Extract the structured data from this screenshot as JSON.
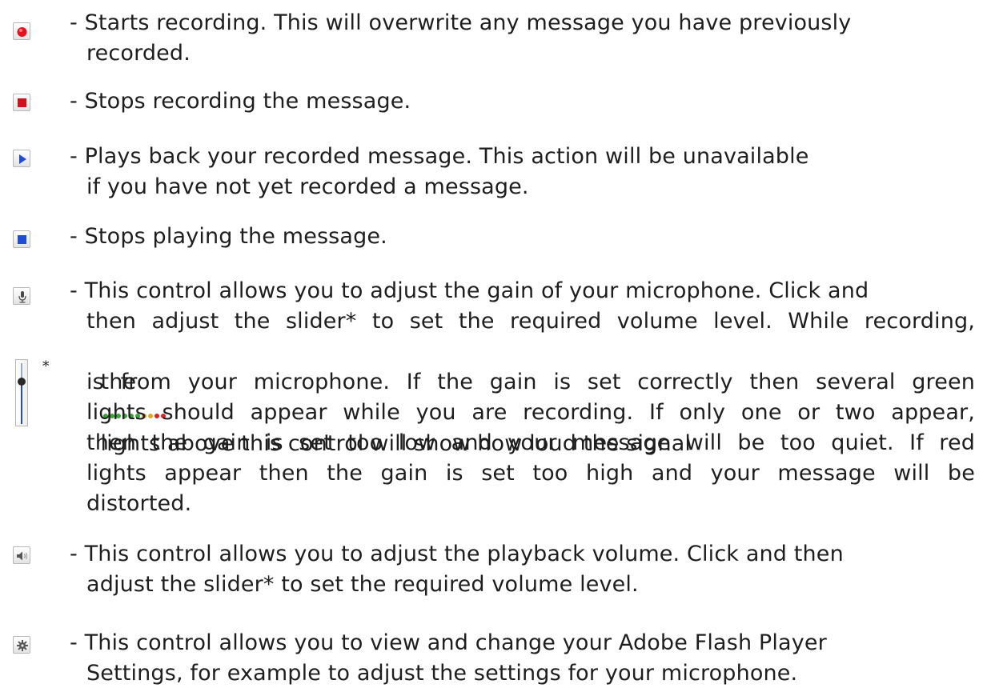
{
  "items": [
    {
      "icon": "record-icon",
      "lines": [
        "- Starts recording. This will overwrite any message you have previously",
        "recorded."
      ]
    },
    {
      "icon": "stop-recording-icon",
      "lines": [
        "- Stops recording the message."
      ]
    },
    {
      "icon": "play-icon",
      "lines": [
        "- Plays back your recorded message. This action will be unavailable",
        "if you have not yet recorded a message."
      ]
    },
    {
      "icon": "stop-playing-icon",
      "lines": [
        "- Stops playing the message."
      ]
    },
    {
      "icon": "microphone-icon",
      "lines": [
        "- This control allows you to adjust the gain of your microphone. Click and",
        "then adjust the slider* to set the required volume level. While recording,",
        "the",
        "lights above this control will show how loud the signal",
        "is from your microphone. If the gain is set correctly then several green",
        "lights should appear while you are recording. If only one or two appear,",
        "then the gain is set too low and your message will be too quiet. If red",
        "lights appear then the gain is set too high and your message will be",
        "distorted."
      ],
      "slider_icon": "slider-icon",
      "asterisk": "*",
      "level_lights_icon": "level-lights-icon",
      "level_light_colors": [
        "#3aa33a",
        "#3aa33a",
        "#3aa33a",
        "#3aa33a",
        "#3aa33a",
        "#3aa33a",
        "#e8a21e",
        "#e8a21e",
        "#e02020",
        "#e02020"
      ]
    },
    {
      "icon": "speaker-volume-icon",
      "lines": [
        "- This control allows you to adjust the playback volume. Click and then",
        "adjust the slider* to set the required volume level."
      ]
    },
    {
      "icon": "gear-settings-icon",
      "lines": [
        "- This control allows you to view and change your Adobe Flash Player",
        "Settings, for example to adjust the settings for your microphone."
      ]
    }
  ]
}
